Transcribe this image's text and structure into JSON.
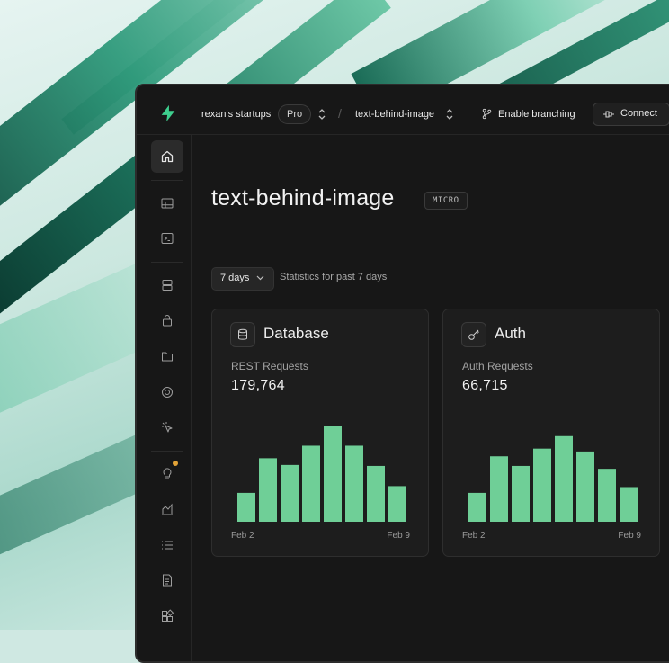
{
  "topbar": {
    "org_name": "rexan's startups",
    "plan_badge": "Pro",
    "project_name": "text-behind-image",
    "branching_label": "Enable branching",
    "connect_label": "Connect"
  },
  "sidebar": {
    "items": [
      {
        "icon": "home-icon",
        "active": true
      },
      {
        "icon": "table-icon"
      },
      {
        "icon": "terminal-icon"
      },
      {
        "icon": "database-icon"
      },
      {
        "icon": "lock-icon"
      },
      {
        "icon": "storage-icon"
      },
      {
        "icon": "realtime-icon"
      },
      {
        "icon": "cursor-click-icon"
      },
      {
        "icon": "lightbulb-icon",
        "notification": true
      },
      {
        "icon": "reports-icon"
      },
      {
        "icon": "list-icon"
      },
      {
        "icon": "document-icon"
      },
      {
        "icon": "integrations-icon"
      }
    ]
  },
  "main": {
    "project_title": "text-behind-image",
    "compute_badge": "MICRO",
    "period_label": "7 days",
    "period_caption": "Statistics for past 7 days"
  },
  "cards": [
    {
      "title": "Database",
      "icon": "database-icon",
      "metric_label": "REST Requests",
      "metric_value": "179,764",
      "start_date": "Feb 2",
      "end_date": "Feb 9"
    },
    {
      "title": "Auth",
      "icon": "key-icon",
      "metric_label": "Auth Requests",
      "metric_value": "66,715",
      "start_date": "Feb 2",
      "end_date": "Feb 9"
    }
  ],
  "chart_data": [
    {
      "type": "bar",
      "title": "Database",
      "values": [
        0.3,
        0.66,
        0.59,
        0.79,
        1.0,
        0.79,
        0.58,
        0.37
      ],
      "x_start": "Feb 2",
      "x_end": "Feb 9",
      "bar_color": "#6fcf97"
    },
    {
      "type": "bar",
      "title": "Auth",
      "values": [
        0.3,
        0.68,
        0.58,
        0.76,
        0.89,
        0.73,
        0.55,
        0.36
      ],
      "x_start": "Feb 2",
      "x_end": "Feb 9",
      "bar_color": "#6fcf97"
    }
  ],
  "colors": {
    "accent": "#3ecf8e",
    "bar": "#6fcf97",
    "badge_dot": "#e2a337"
  }
}
